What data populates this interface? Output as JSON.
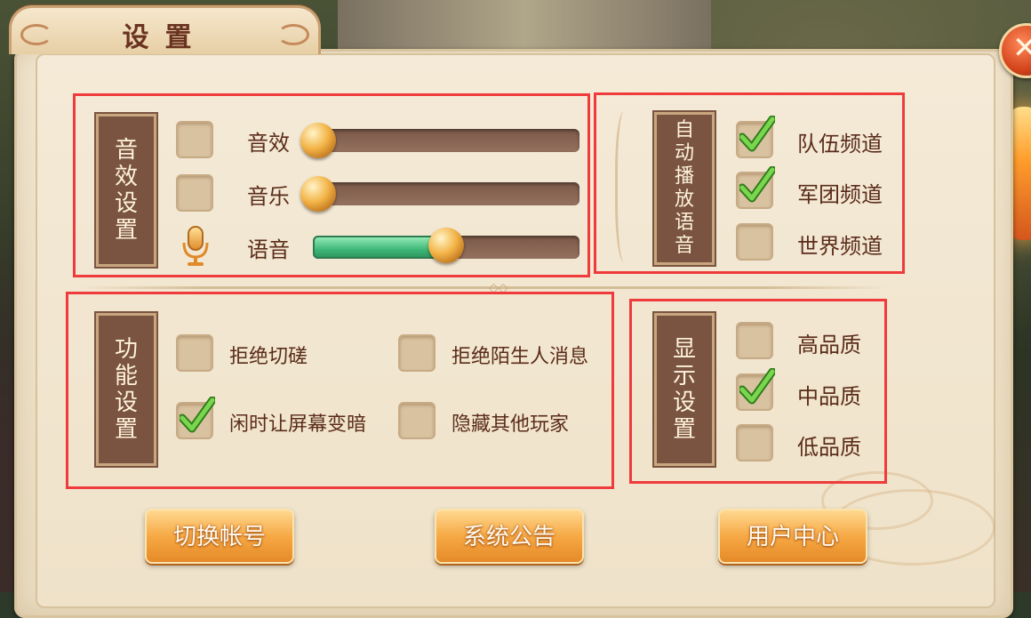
{
  "window": {
    "title": "设置"
  },
  "close": {
    "glyph": "✕"
  },
  "sound_settings": {
    "heading_chars": [
      "音",
      "效",
      "设",
      "置"
    ],
    "rows": [
      {
        "label": "音效",
        "enabled": false,
        "volume": 0.0
      },
      {
        "label": "音乐",
        "enabled": false,
        "volume": 0.0
      },
      {
        "label": "语音",
        "icon": "microphone-icon",
        "volume": 0.5
      }
    ]
  },
  "auto_voice": {
    "heading_chars": [
      "自",
      "动",
      "播",
      "放",
      "语",
      "音"
    ],
    "options": [
      {
        "label": "队伍频道",
        "checked": true
      },
      {
        "label": "军团频道",
        "checked": true
      },
      {
        "label": "世界频道",
        "checked": false
      }
    ]
  },
  "function_settings": {
    "heading_chars": [
      "功",
      "能",
      "设",
      "置"
    ],
    "options": [
      {
        "label": "拒绝切磋",
        "checked": false
      },
      {
        "label": "拒绝陌生人消息",
        "checked": false
      },
      {
        "label": "闲时让屏幕变暗",
        "checked": true
      },
      {
        "label": "隐藏其他玩家",
        "checked": false
      }
    ]
  },
  "display_settings": {
    "heading_chars": [
      "显",
      "示",
      "设",
      "置"
    ],
    "options": [
      {
        "label": "高品质",
        "checked": false
      },
      {
        "label": "中品质",
        "checked": true
      },
      {
        "label": "低品质",
        "checked": false
      }
    ]
  },
  "buttons": {
    "switch_account": "切换帐号",
    "announcement": "系统公告",
    "user_center": "用户中心"
  },
  "colors": {
    "highlight_box": "#ef3b3b",
    "check_green": "#5ac23a",
    "accent_orange": "#f6a945"
  }
}
